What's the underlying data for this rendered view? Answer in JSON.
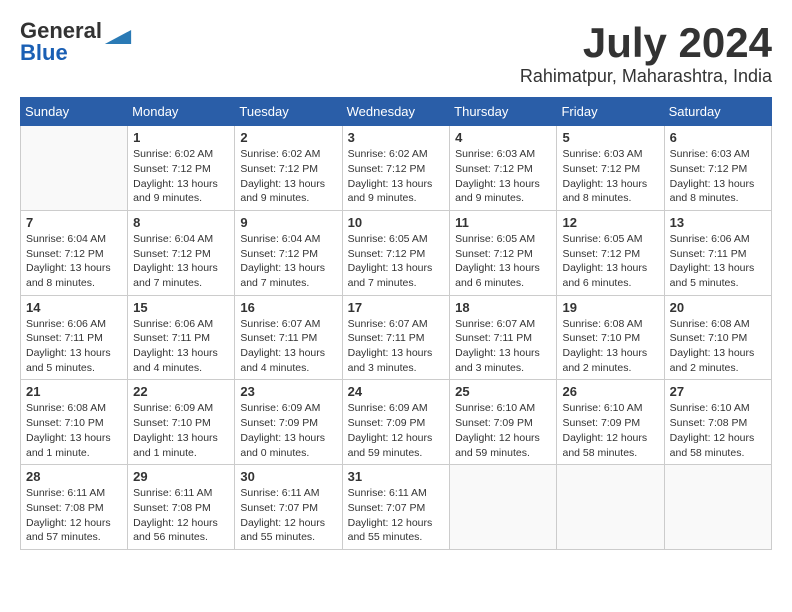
{
  "logo": {
    "general": "General",
    "blue": "Blue"
  },
  "title": "July 2024",
  "location": "Rahimatpur, Maharashtra, India",
  "days_of_week": [
    "Sunday",
    "Monday",
    "Tuesday",
    "Wednesday",
    "Thursday",
    "Friday",
    "Saturday"
  ],
  "weeks": [
    [
      {
        "num": "",
        "info": ""
      },
      {
        "num": "1",
        "info": "Sunrise: 6:02 AM\nSunset: 7:12 PM\nDaylight: 13 hours\nand 9 minutes."
      },
      {
        "num": "2",
        "info": "Sunrise: 6:02 AM\nSunset: 7:12 PM\nDaylight: 13 hours\nand 9 minutes."
      },
      {
        "num": "3",
        "info": "Sunrise: 6:02 AM\nSunset: 7:12 PM\nDaylight: 13 hours\nand 9 minutes."
      },
      {
        "num": "4",
        "info": "Sunrise: 6:03 AM\nSunset: 7:12 PM\nDaylight: 13 hours\nand 9 minutes."
      },
      {
        "num": "5",
        "info": "Sunrise: 6:03 AM\nSunset: 7:12 PM\nDaylight: 13 hours\nand 8 minutes."
      },
      {
        "num": "6",
        "info": "Sunrise: 6:03 AM\nSunset: 7:12 PM\nDaylight: 13 hours\nand 8 minutes."
      }
    ],
    [
      {
        "num": "7",
        "info": "Sunrise: 6:04 AM\nSunset: 7:12 PM\nDaylight: 13 hours\nand 8 minutes."
      },
      {
        "num": "8",
        "info": "Sunrise: 6:04 AM\nSunset: 7:12 PM\nDaylight: 13 hours\nand 7 minutes."
      },
      {
        "num": "9",
        "info": "Sunrise: 6:04 AM\nSunset: 7:12 PM\nDaylight: 13 hours\nand 7 minutes."
      },
      {
        "num": "10",
        "info": "Sunrise: 6:05 AM\nSunset: 7:12 PM\nDaylight: 13 hours\nand 7 minutes."
      },
      {
        "num": "11",
        "info": "Sunrise: 6:05 AM\nSunset: 7:12 PM\nDaylight: 13 hours\nand 6 minutes."
      },
      {
        "num": "12",
        "info": "Sunrise: 6:05 AM\nSunset: 7:12 PM\nDaylight: 13 hours\nand 6 minutes."
      },
      {
        "num": "13",
        "info": "Sunrise: 6:06 AM\nSunset: 7:11 PM\nDaylight: 13 hours\nand 5 minutes."
      }
    ],
    [
      {
        "num": "14",
        "info": "Sunrise: 6:06 AM\nSunset: 7:11 PM\nDaylight: 13 hours\nand 5 minutes."
      },
      {
        "num": "15",
        "info": "Sunrise: 6:06 AM\nSunset: 7:11 PM\nDaylight: 13 hours\nand 4 minutes."
      },
      {
        "num": "16",
        "info": "Sunrise: 6:07 AM\nSunset: 7:11 PM\nDaylight: 13 hours\nand 4 minutes."
      },
      {
        "num": "17",
        "info": "Sunrise: 6:07 AM\nSunset: 7:11 PM\nDaylight: 13 hours\nand 3 minutes."
      },
      {
        "num": "18",
        "info": "Sunrise: 6:07 AM\nSunset: 7:11 PM\nDaylight: 13 hours\nand 3 minutes."
      },
      {
        "num": "19",
        "info": "Sunrise: 6:08 AM\nSunset: 7:10 PM\nDaylight: 13 hours\nand 2 minutes."
      },
      {
        "num": "20",
        "info": "Sunrise: 6:08 AM\nSunset: 7:10 PM\nDaylight: 13 hours\nand 2 minutes."
      }
    ],
    [
      {
        "num": "21",
        "info": "Sunrise: 6:08 AM\nSunset: 7:10 PM\nDaylight: 13 hours\nand 1 minute."
      },
      {
        "num": "22",
        "info": "Sunrise: 6:09 AM\nSunset: 7:10 PM\nDaylight: 13 hours\nand 1 minute."
      },
      {
        "num": "23",
        "info": "Sunrise: 6:09 AM\nSunset: 7:09 PM\nDaylight: 13 hours\nand 0 minutes."
      },
      {
        "num": "24",
        "info": "Sunrise: 6:09 AM\nSunset: 7:09 PM\nDaylight: 12 hours\nand 59 minutes."
      },
      {
        "num": "25",
        "info": "Sunrise: 6:10 AM\nSunset: 7:09 PM\nDaylight: 12 hours\nand 59 minutes."
      },
      {
        "num": "26",
        "info": "Sunrise: 6:10 AM\nSunset: 7:09 PM\nDaylight: 12 hours\nand 58 minutes."
      },
      {
        "num": "27",
        "info": "Sunrise: 6:10 AM\nSunset: 7:08 PM\nDaylight: 12 hours\nand 58 minutes."
      }
    ],
    [
      {
        "num": "28",
        "info": "Sunrise: 6:11 AM\nSunset: 7:08 PM\nDaylight: 12 hours\nand 57 minutes."
      },
      {
        "num": "29",
        "info": "Sunrise: 6:11 AM\nSunset: 7:08 PM\nDaylight: 12 hours\nand 56 minutes."
      },
      {
        "num": "30",
        "info": "Sunrise: 6:11 AM\nSunset: 7:07 PM\nDaylight: 12 hours\nand 55 minutes."
      },
      {
        "num": "31",
        "info": "Sunrise: 6:11 AM\nSunset: 7:07 PM\nDaylight: 12 hours\nand 55 minutes."
      },
      {
        "num": "",
        "info": ""
      },
      {
        "num": "",
        "info": ""
      },
      {
        "num": "",
        "info": ""
      }
    ]
  ]
}
